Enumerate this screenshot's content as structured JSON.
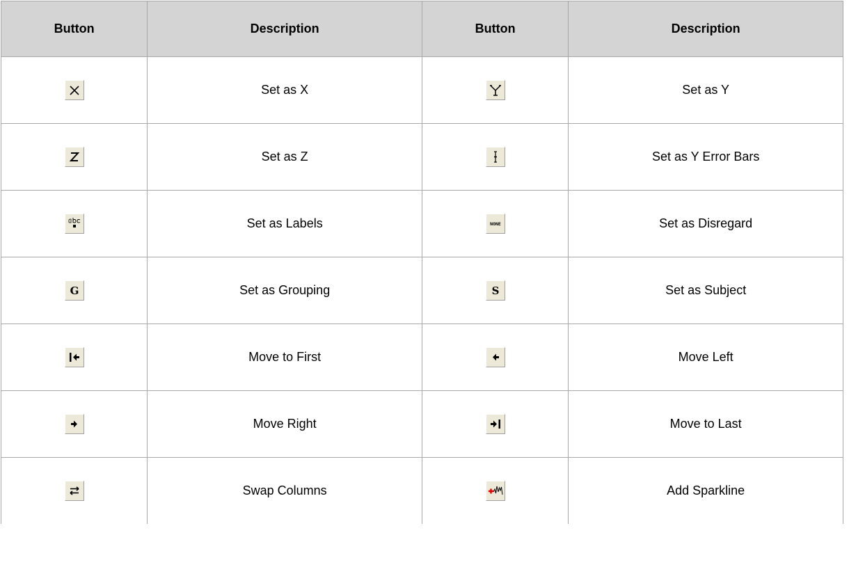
{
  "headers": {
    "button1": "Button",
    "desc1": "Description",
    "button2": "Button",
    "desc2": "Description"
  },
  "rows": [
    {
      "left": {
        "icon": "set-as-x-icon",
        "desc": "Set as X"
      },
      "right": {
        "icon": "set-as-y-icon",
        "desc": "Set as Y"
      }
    },
    {
      "left": {
        "icon": "set-as-z-icon",
        "desc": "Set as Z"
      },
      "right": {
        "icon": "y-error-bars-icon",
        "desc": "Set as Y Error Bars"
      }
    },
    {
      "left": {
        "icon": "labels-abc-icon",
        "desc": "Set as Labels"
      },
      "right": {
        "icon": "none-disregard-icon",
        "desc": "Set as Disregard"
      }
    },
    {
      "left": {
        "icon": "grouping-g-icon",
        "desc": "Set as Grouping"
      },
      "right": {
        "icon": "subject-s-icon",
        "desc": "Set as Subject"
      }
    },
    {
      "left": {
        "icon": "move-to-first-icon",
        "desc": "Move to First"
      },
      "right": {
        "icon": "move-left-icon",
        "desc": "Move Left"
      }
    },
    {
      "left": {
        "icon": "move-right-icon",
        "desc": "Move Right"
      },
      "right": {
        "icon": "move-to-last-icon",
        "desc": "Move to Last"
      }
    },
    {
      "left": {
        "icon": "swap-columns-icon",
        "desc": "Swap Columns"
      },
      "right": {
        "icon": "add-sparkline-icon",
        "desc": "Add Sparkline"
      }
    }
  ],
  "icon_text": {
    "x": "X",
    "y": "Y",
    "z": "Z",
    "abc": "abc",
    "none": "NONE",
    "g": "G",
    "s": "S"
  },
  "colors": {
    "header_bg": "#d4d4d4",
    "button_face": "#ece9d8",
    "border": "#a8a8a8",
    "sparkline_plus": "#e00000"
  }
}
